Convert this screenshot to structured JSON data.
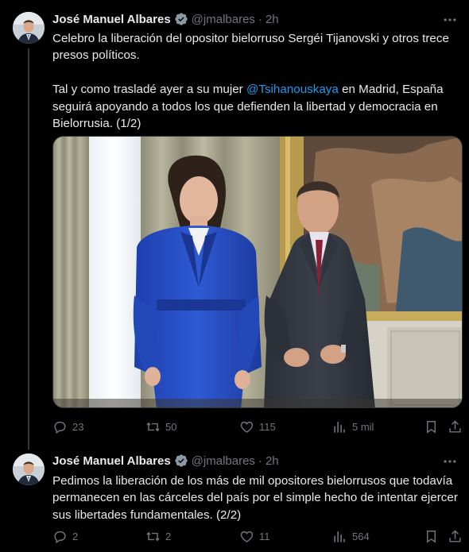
{
  "tweets": [
    {
      "author_name": "José Manuel Albares",
      "handle": "@jmalbares",
      "separator": "·",
      "time": "2h",
      "text_line1": "Celebro la liberación del opositor bielorruso Sergéi Tijanovski y otros trece",
      "text_line2": "presos políticos.",
      "text_line3_pre": "Tal y como trasladé ayer a su mujer ",
      "mention": "@Tsihanouskaya",
      "text_line3_post": " en Madrid, España",
      "text_line4": "seguirá apoyando a todos los que defienden la libertad y democracia en",
      "text_line5": "Bielorrusia. (1/2)",
      "replies": "23",
      "reposts": "50",
      "likes": "115",
      "views": "5 mil"
    },
    {
      "author_name": "José Manuel Albares",
      "handle": "@jmalbares",
      "separator": "·",
      "time": "2h",
      "text_line1": "Pedimos la liberación de los más de mil opositores bielorrusos que todavía",
      "text_line2": "permanecen en las cárceles del país por el simple hecho de intentar ejercer",
      "text_line3": "sus libertades fundamentales. (2/2)",
      "replies": "2",
      "reposts": "2",
      "likes": "11",
      "views": "564"
    }
  ],
  "icons": {
    "more": "more-horizontal-icon",
    "verified": "verified-badge-icon",
    "reply": "reply-icon",
    "repost": "repost-icon",
    "like": "like-icon",
    "views": "views-icon",
    "bookmark": "bookmark-icon",
    "share": "share-icon"
  },
  "colors": {
    "background": "#000000",
    "text": "#e7e9ea",
    "muted": "#71767b",
    "link": "#1d9bf0",
    "verified": "#8b98a5"
  }
}
